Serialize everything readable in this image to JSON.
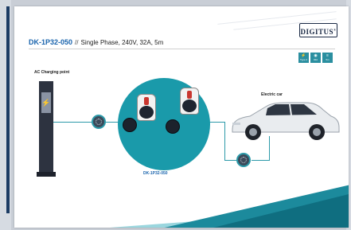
{
  "header": {
    "model": "DK-1P32-050",
    "separator": "//",
    "description": "Single Phase, 240V, 32A, 5m"
  },
  "logo": {
    "text": "DIGITUS",
    "mark": "®"
  },
  "badges": [
    {
      "glyph": "⚡",
      "label": "Type 2"
    },
    {
      "glyph": "◉",
      "label": "32A"
    },
    {
      "glyph": "≡",
      "label": "5m"
    }
  ],
  "diagram": {
    "charging_point_label": "AC Charging point",
    "car_label": "Electric car",
    "cable_label": "DK-1P32-050",
    "pillar_glyph": "⚡"
  },
  "colors": {
    "brand_blue": "#1a64ad",
    "teal": "#1a9aaa",
    "dark_teal": "#0f6e80",
    "pillar": "#2d3340"
  }
}
